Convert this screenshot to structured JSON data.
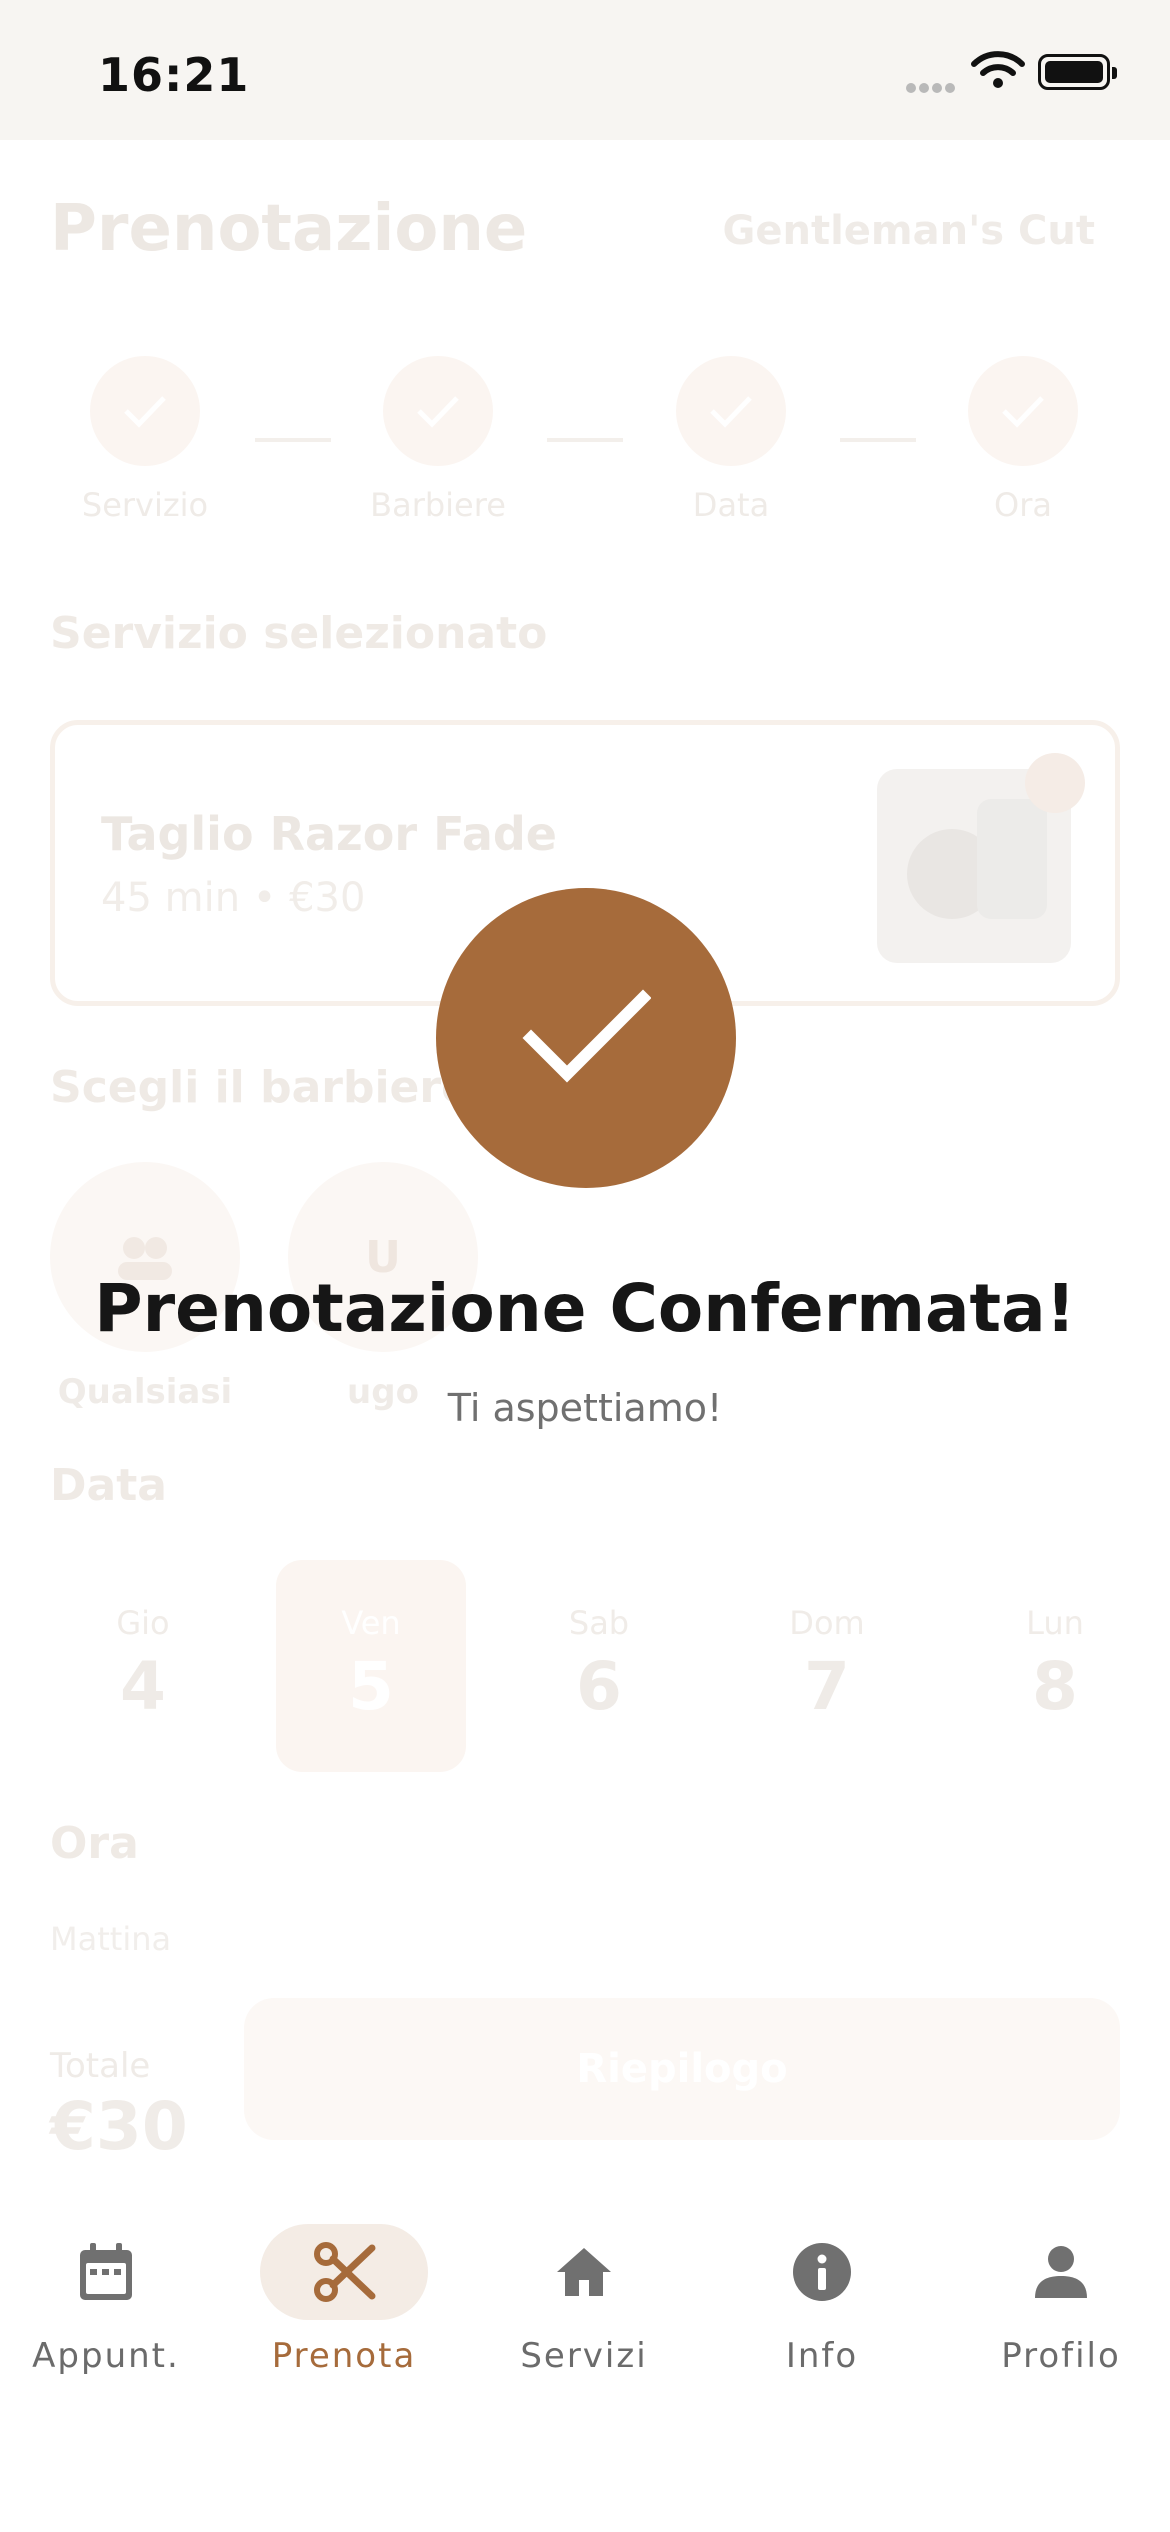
{
  "status_bar": {
    "time": "16:21"
  },
  "background": {
    "title": "Prenotazione",
    "shop_name": "Gentleman's Cut",
    "steps": [
      {
        "label": "Servizio"
      },
      {
        "label": "Barbiere"
      },
      {
        "label": "Data"
      },
      {
        "label": "Ora"
      }
    ],
    "selected_service_heading": "Servizio selezionato",
    "service": {
      "name": "Taglio Razor Fade",
      "meta": "45 min • €30"
    },
    "barber_heading": "Scegli il barbiere",
    "barbers": [
      {
        "name": "Qualsiasi",
        "initial": ""
      },
      {
        "name": "ugo",
        "initial": "U"
      }
    ],
    "date_heading": "Data",
    "days": [
      {
        "name": "Gio",
        "num": "4"
      },
      {
        "name": "Ven",
        "num": "5"
      },
      {
        "name": "Sab",
        "num": "6"
      },
      {
        "name": "Dom",
        "num": "7"
      },
      {
        "name": "Lun",
        "num": "8"
      }
    ],
    "time_heading": "Ora",
    "morning_label": "Mattina",
    "total_label": "Totale",
    "total_value": "€30",
    "summary_button": "Riepilogo"
  },
  "confirmation": {
    "title": "Prenotazione Confermata!",
    "subtitle": "Ti aspettiamo!"
  },
  "tabbar": {
    "tabs": [
      {
        "label": "Appunt.",
        "icon": "calendar-icon"
      },
      {
        "label": "Prenota",
        "icon": "scissors-icon",
        "active": true
      },
      {
        "label": "Servizi",
        "icon": "home-icon"
      },
      {
        "label": "Info",
        "icon": "info-icon"
      },
      {
        "label": "Profilo",
        "icon": "person-icon"
      }
    ]
  },
  "colors": {
    "accent": "#a66b3b",
    "accent_light": "#f4ece5",
    "status_bar_bg": "#f7f5f2"
  }
}
